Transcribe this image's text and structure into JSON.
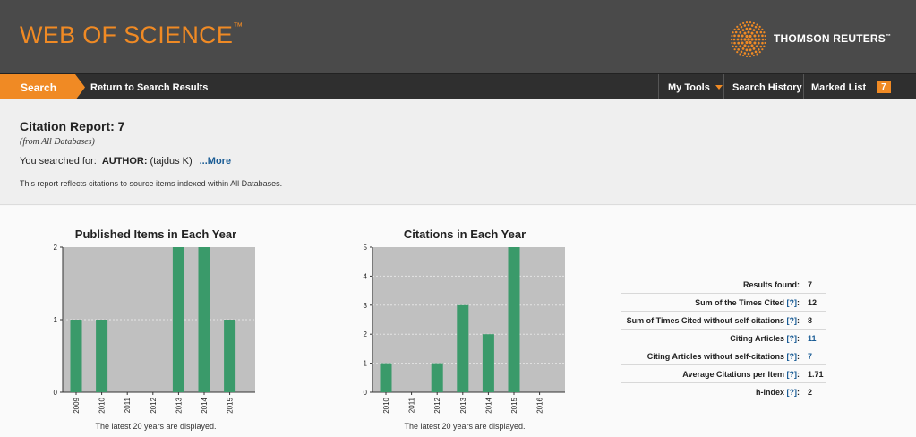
{
  "header": {
    "logo": "WEB OF SCIENCE",
    "logo_tm": "™",
    "brand": "THOMSON REUTERS",
    "brand_tm": "™",
    "accent": "#f08a24"
  },
  "nav": {
    "search": "Search",
    "return": "Return to Search Results",
    "my_tools": "My Tools",
    "search_history": "Search History",
    "marked_list": "Marked List",
    "marked_count": "7"
  },
  "report": {
    "title": "Citation Report: 7",
    "db": "(from All Databases)",
    "searched_label": "You searched for:",
    "query_field": "AUTHOR:",
    "query_term": "(tajdus K)",
    "more": "...More",
    "note": "This report reflects citations to source items indexed within All Databases."
  },
  "charts": {
    "published_title": "Published Items in Each Year",
    "citations_title": "Citations in Each Year",
    "footer": "The latest 20 years are displayed."
  },
  "chart_data": [
    {
      "type": "bar",
      "title": "Published Items in Each Year",
      "categories": [
        "2009",
        "2010",
        "2011",
        "2012",
        "2013",
        "2014",
        "2015"
      ],
      "values": [
        1,
        1,
        0,
        0,
        2,
        2,
        1
      ],
      "ylim": [
        0,
        2
      ],
      "yticks": [
        "0",
        "1",
        "2"
      ],
      "bar_color": "#3a9a6a",
      "plot_bg": "#c0c0c0",
      "grid": true
    },
    {
      "type": "bar",
      "title": "Citations in Each Year",
      "categories": [
        "2010",
        "2011",
        "2012",
        "2013",
        "2014",
        "2015",
        "2016"
      ],
      "values": [
        1,
        0,
        1,
        3,
        2,
        5,
        0
      ],
      "ylim": [
        0,
        5
      ],
      "yticks": [
        "0",
        "1",
        "2",
        "3",
        "4",
        "5"
      ],
      "bar_color": "#3a9a6a",
      "plot_bg": "#c0c0c0",
      "grid": true
    }
  ],
  "stats": {
    "rows": [
      {
        "label": "Results found:",
        "help": "",
        "value": "7",
        "link": false
      },
      {
        "label": "Sum of the Times Cited",
        "help": "[?]",
        "value": "12",
        "link": false
      },
      {
        "label": "Sum of Times Cited without self-citations",
        "help": "[?]",
        "value": "8",
        "link": false
      },
      {
        "label": "Citing Articles",
        "help": "[?]",
        "value": "11",
        "link": true
      },
      {
        "label": "Citing Articles without self-citations",
        "help": "[?]",
        "value": "7",
        "link": true
      },
      {
        "label": "Average Citations per Item",
        "help": "[?]",
        "value": "1.71",
        "link": false
      },
      {
        "label": "h-index",
        "help": "[?]",
        "value": "2",
        "link": false
      }
    ]
  }
}
